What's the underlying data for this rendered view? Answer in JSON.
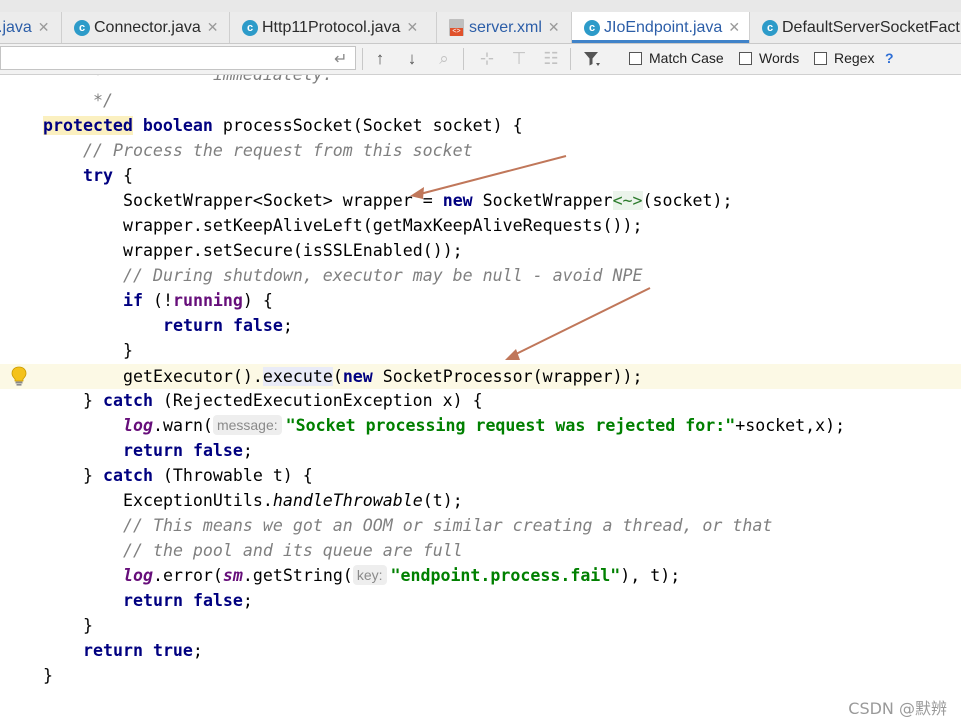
{
  "tabs": [
    {
      "label": ".java",
      "type": "java",
      "active": false
    },
    {
      "label": "Connector.java",
      "type": "class",
      "active": false
    },
    {
      "label": "Http11Protocol.java",
      "type": "class",
      "active": false
    },
    {
      "label": "server.xml",
      "type": "xml",
      "active": false
    },
    {
      "label": "JIoEndpoint.java",
      "type": "class",
      "active": true
    },
    {
      "label": "DefaultServerSocketFact",
      "type": "class",
      "active": false
    }
  ],
  "icons": {
    "class": "class-icon",
    "xml": "xml-file-icon",
    "close": "close-icon",
    "lightbulb": "lightbulb-icon"
  },
  "find": {
    "query": "",
    "match_case": "Match Case",
    "words": "Words",
    "regex": "Regex",
    "help": "?"
  },
  "code": {
    "l1": "     *           immediately.",
    "l2": "     */",
    "l3_kw1": "protected",
    "l3_kw2": "boolean",
    "l3_rest": " processSocket(Socket socket) {",
    "l4": "// Process the request from this socket",
    "l5_kw": "try",
    "l5_rest": " {",
    "l6_a": "SocketWrapper<Socket> wrapper = ",
    "l6_new": "new",
    "l6_b": " SocketWrapper",
    "l6_diamond": "<~>",
    "l6_c": "(socket);",
    "l7": "wrapper.setKeepAliveLeft(getMaxKeepAliveRequests());",
    "l8": "wrapper.setSecure(isSSLEnabled());",
    "l9": "// During shutdown, executor may be null - avoid NPE",
    "l10_kw": "if",
    "l10_a": " (!",
    "l10_field": "running",
    "l10_b": ") {",
    "l11_kw1": "return",
    "l11_kw2": "false",
    "l11_end": ";",
    "l12": "}",
    "l13_a": "getExecutor().",
    "l13_method": "execute",
    "l13_b": "(",
    "l13_new": "new",
    "l13_c": " SocketProcessor(wrapper));",
    "l14_a": "} ",
    "l14_kw": "catch",
    "l14_b": " (RejectedExecutionException x) {",
    "l15_log": "log",
    "l15_a": ".warn(",
    "l15_hint": "message:",
    "l15_str": "\"Socket processing request was rejected for:\"",
    "l15_b": "+socket,x);",
    "l16_kw1": "return",
    "l16_kw2": "false",
    "l16_end": ";",
    "l17_a": "} ",
    "l17_kw": "catch",
    "l17_b": " (Throwable t) {",
    "l18_a": "ExceptionUtils.",
    "l18_method": "handleThrowable",
    "l18_b": "(t);",
    "l19": "// This means we got an OOM or similar creating a thread, or that",
    "l20": "// the pool and its queue are full",
    "l21_log": "log",
    "l21_a": ".error(",
    "l21_sm": "sm",
    "l21_b": ".getString(",
    "l21_hint": "key:",
    "l21_str": "\"endpoint.process.fail\"",
    "l21_c": "), t);",
    "l22_kw1": "return",
    "l22_kw2": "false",
    "l22_end": ";",
    "l23": "}",
    "l24_kw1": "return",
    "l24_kw2": "true",
    "l24_end": ";",
    "l25": "}"
  },
  "watermark": "CSDN @默辨"
}
